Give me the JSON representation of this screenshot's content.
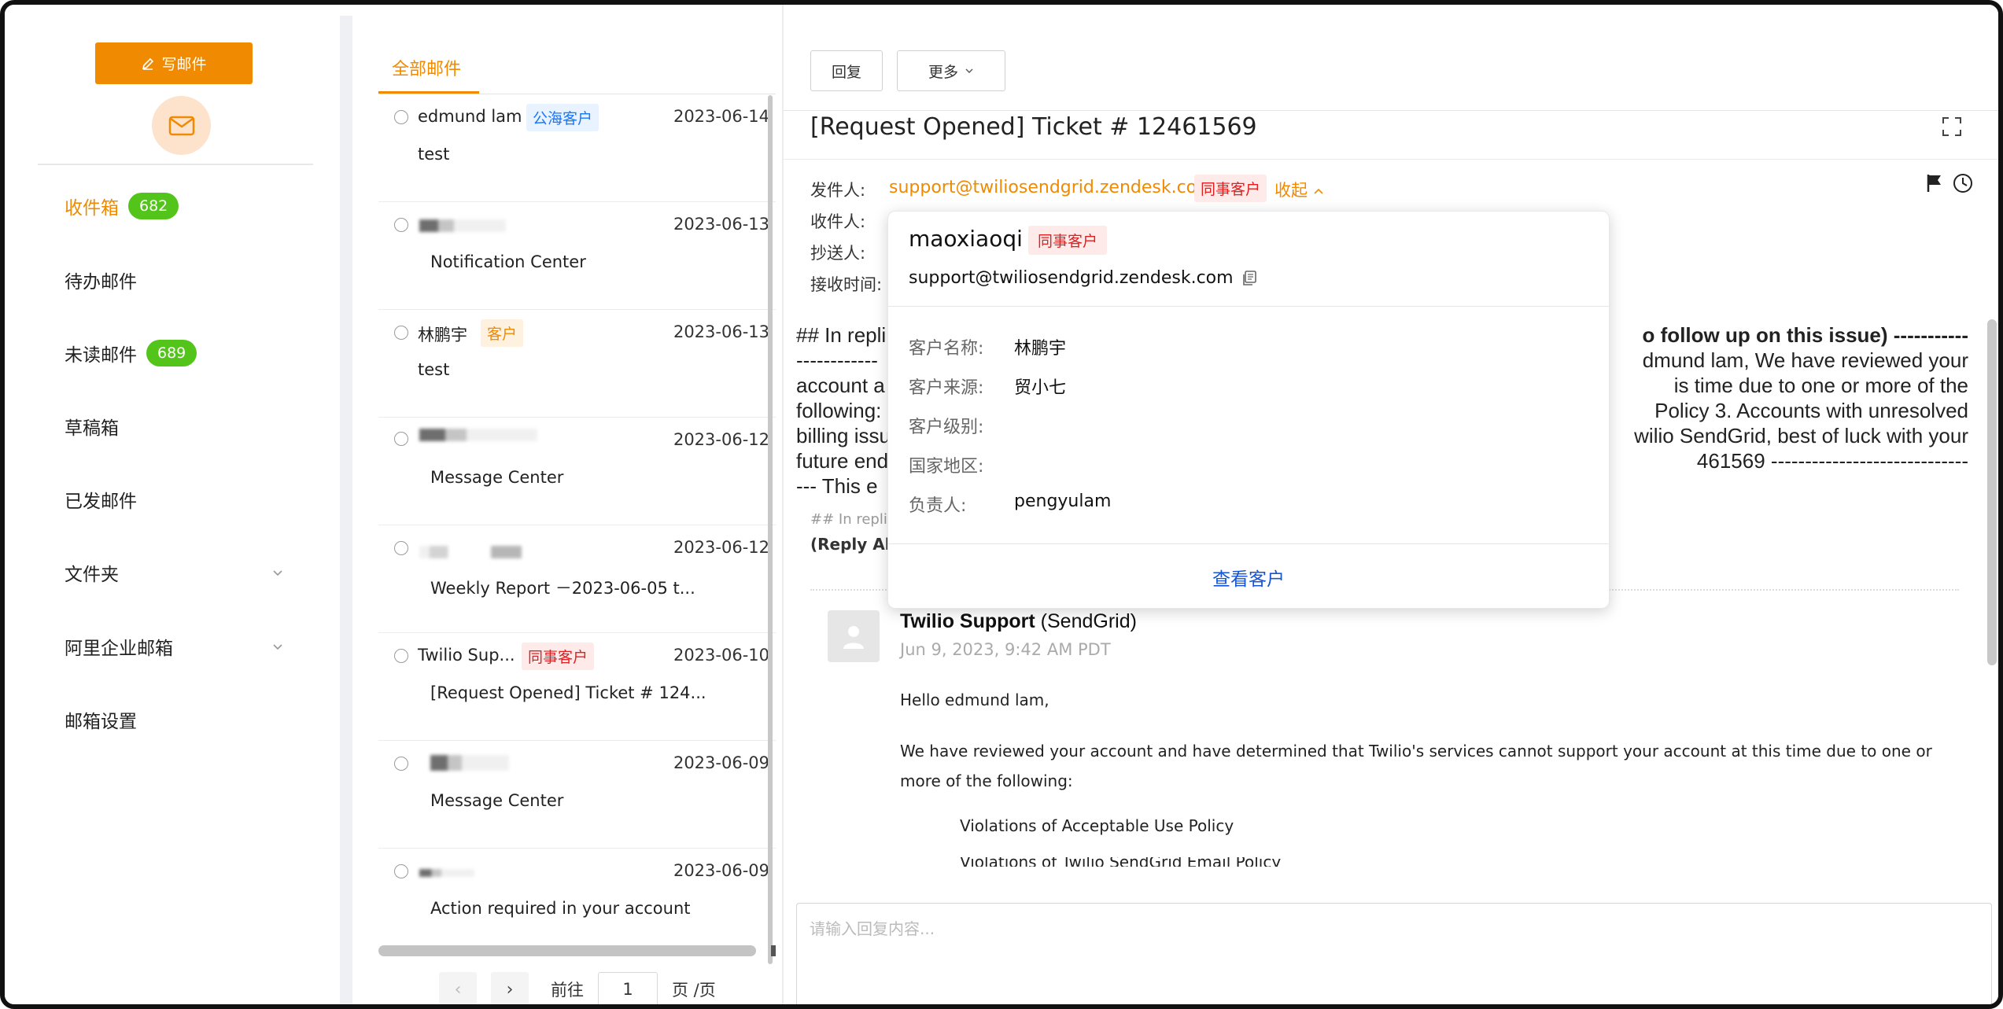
{
  "sidebar": {
    "compose_label": "写邮件",
    "items": [
      {
        "label": "收件箱",
        "badge": "682"
      },
      {
        "label": "待办邮件"
      },
      {
        "label": "未读邮件",
        "badge": "689"
      },
      {
        "label": "草稿箱"
      },
      {
        "label": "已发邮件"
      },
      {
        "label": "文件夹"
      },
      {
        "label": "阿里企业邮箱"
      },
      {
        "label": "邮箱设置"
      }
    ]
  },
  "list": {
    "tab": "全部邮件",
    "items": [
      {
        "sender": "edmund lam",
        "tag": "公海客户",
        "date": "2023-06-14",
        "subject": "test"
      },
      {
        "sender": "",
        "date": "2023-06-13",
        "subject": "Notification Center"
      },
      {
        "sender": "林鹏宇",
        "tag": "客户",
        "date": "2023-06-13",
        "subject": "test"
      },
      {
        "sender": "",
        "date": "2023-06-12",
        "subject": "Message Center"
      },
      {
        "sender": "",
        "date": "2023-06-12",
        "subject": "Weekly Report －2023-06-05 t..."
      },
      {
        "sender": "Twilio Sup...",
        "tag": "同事客户",
        "date": "2023-06-10",
        "subject": "[Request Opened] Ticket # 124..."
      },
      {
        "sender": "",
        "date": "2023-06-09",
        "subject": "Message Center"
      },
      {
        "sender": "",
        "date": "2023-06-09",
        "subject": "Action required in your account"
      }
    ],
    "pager": {
      "goto": "前往",
      "page": "1",
      "suffix": "页 /页"
    }
  },
  "reader": {
    "reply_button": "回复",
    "more_button": "更多",
    "title": "[Request Opened] Ticket # 12461569",
    "from_label": "发件人:",
    "to_label": "收件人:",
    "cc_label": "抄送人:",
    "time_label": "接收时间:",
    "sender_email": "support@twiliosendgrid.zendesk.com",
    "sender_tag": "同事客户",
    "collapse_label": "收起",
    "body_line1_left": "## In repli",
    "body_line1_right": "o follow up on this issue) -----------",
    "body_line2_left": "------------",
    "body_line2_right": "dmund lam, We have reviewed your",
    "body_line3_left": "account a",
    "body_line3_right": "is time due to one or more of the",
    "body_line4_left": "following:",
    "body_line4_right": "Policy 3. Accounts with unresolved",
    "body_line5_left": "billing issu",
    "body_line5_right": "wilio SendGrid, best of luck with your",
    "body_line6_left": "future end",
    "body_line6_right": "461569 -----------------------------",
    "body_line7_left": "--- This e",
    "small_line": "## In repli",
    "bold_line": "(Reply All",
    "support_name": "Twilio Support",
    "support_org": " (SendGrid)",
    "support_date": "Jun 9, 2023, 9:42 AM PDT",
    "greeting": "Hello edmund lam,",
    "paragraph": "We have reviewed your account and have determined that Twilio's services cannot support your account at this time due to one or more of the following:",
    "bullet1": "Violations of Acceptable Use Policy",
    "bullet2": "Violations of Twilio SendGrid Email Policy",
    "reply_placeholder": "请输入回复内容..."
  },
  "popover": {
    "name": "maoxiaoqi",
    "tag": "同事客户",
    "email": "support@twiliosendgrid.zendesk.com",
    "fields": [
      {
        "label": "客户名称:",
        "value": "林鹏宇"
      },
      {
        "label": "客户来源:",
        "value": "贸小七"
      },
      {
        "label": "客户级别:",
        "value": ""
      },
      {
        "label": "国家地区:",
        "value": ""
      },
      {
        "label": "负责人:",
        "value": "pengyulam"
      }
    ],
    "link": "查看客户"
  }
}
